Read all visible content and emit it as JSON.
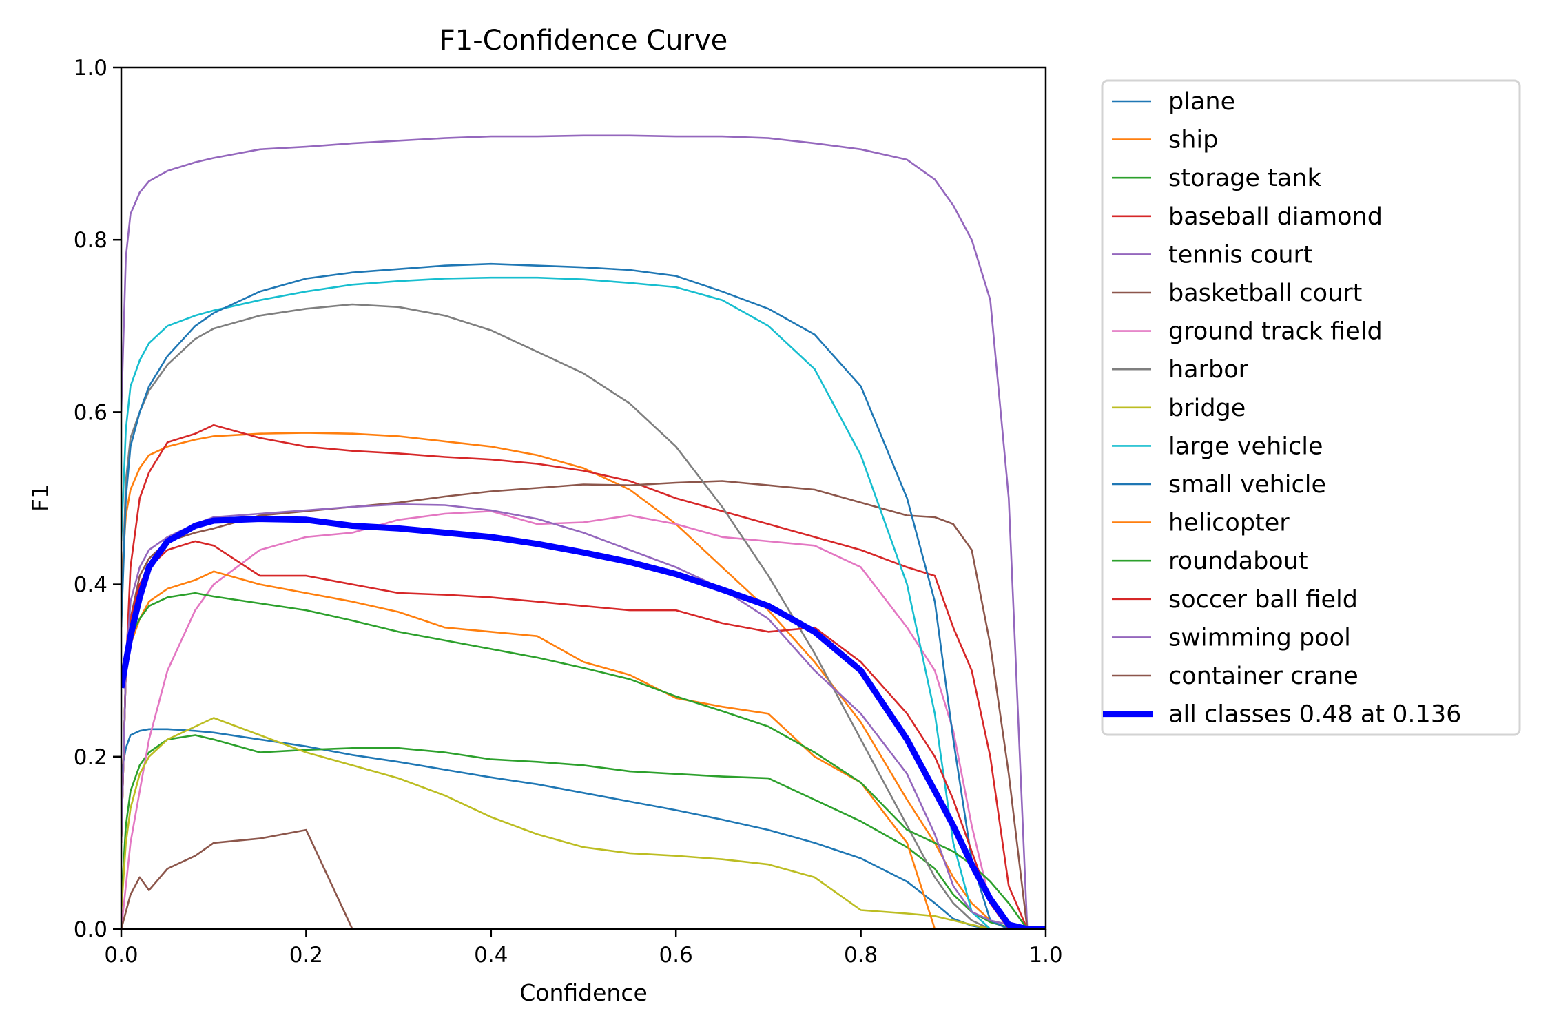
{
  "chart_data": {
    "type": "line",
    "title": "F1-Confidence Curve",
    "xlabel": "Confidence",
    "ylabel": "F1",
    "xlim": [
      0.0,
      1.0
    ],
    "ylim": [
      0.0,
      1.0
    ],
    "xticks": [
      "0.0",
      "0.2",
      "0.4",
      "0.6",
      "0.8",
      "1.0"
    ],
    "yticks": [
      "0.0",
      "0.2",
      "0.4",
      "0.6",
      "0.8",
      "1.0"
    ],
    "grid": false,
    "legend_position": "outside-right-top",
    "x": [
      0.0,
      0.005,
      0.01,
      0.02,
      0.03,
      0.05,
      0.08,
      0.1,
      0.15,
      0.2,
      0.25,
      0.3,
      0.35,
      0.4,
      0.45,
      0.5,
      0.55,
      0.6,
      0.65,
      0.7,
      0.75,
      0.8,
      0.85,
      0.88,
      0.9,
      0.92,
      0.94,
      0.96,
      0.98,
      1.0
    ],
    "series": [
      {
        "name": "plane",
        "color": "#1f77b4",
        "width": "thin",
        "values": [
          0.18,
          0.21,
          0.225,
          0.23,
          0.232,
          0.232,
          0.23,
          0.228,
          0.22,
          0.212,
          0.202,
          0.194,
          0.185,
          0.176,
          0.168,
          0.158,
          0.148,
          0.138,
          0.127,
          0.115,
          0.1,
          0.082,
          0.055,
          0.03,
          0.012,
          0.004,
          0.0,
          0.0,
          0.0,
          0.0
        ]
      },
      {
        "name": "ship",
        "color": "#ff7f0e",
        "width": "thin",
        "values": [
          0.4,
          0.48,
          0.51,
          0.535,
          0.55,
          0.56,
          0.568,
          0.572,
          0.575,
          0.576,
          0.575,
          0.572,
          0.566,
          0.56,
          0.55,
          0.535,
          0.51,
          0.47,
          0.42,
          0.37,
          0.31,
          0.24,
          0.15,
          0.1,
          0.06,
          0.03,
          0.01,
          0.0,
          0.0,
          0.0
        ]
      },
      {
        "name": "storage tank",
        "color": "#2ca02c",
        "width": "thin",
        "values": [
          0.03,
          0.12,
          0.16,
          0.19,
          0.205,
          0.22,
          0.225,
          0.22,
          0.205,
          0.208,
          0.21,
          0.21,
          0.205,
          0.197,
          0.194,
          0.19,
          0.183,
          0.18,
          0.177,
          0.175,
          0.15,
          0.125,
          0.095,
          0.07,
          0.04,
          0.02,
          0.008,
          0.002,
          0.0,
          0.0
        ]
      },
      {
        "name": "baseball diamond",
        "color": "#d62728",
        "width": "thin",
        "values": [
          0.1,
          0.3,
          0.42,
          0.5,
          0.53,
          0.565,
          0.575,
          0.585,
          0.57,
          0.56,
          0.555,
          0.552,
          0.548,
          0.545,
          0.54,
          0.532,
          0.52,
          0.5,
          0.485,
          0.47,
          0.455,
          0.44,
          0.42,
          0.41,
          0.35,
          0.3,
          0.2,
          0.05,
          0.0,
          0.0
        ]
      },
      {
        "name": "tennis court",
        "color": "#9467bd",
        "width": "thin",
        "values": [
          0.6,
          0.78,
          0.83,
          0.855,
          0.868,
          0.88,
          0.89,
          0.895,
          0.905,
          0.908,
          0.912,
          0.915,
          0.918,
          0.92,
          0.92,
          0.921,
          0.921,
          0.92,
          0.92,
          0.918,
          0.912,
          0.905,
          0.893,
          0.87,
          0.84,
          0.8,
          0.73,
          0.5,
          0.0,
          0.0
        ]
      },
      {
        "name": "basketball court",
        "color": "#8c564b",
        "width": "thin",
        "values": [
          0.1,
          0.3,
          0.36,
          0.41,
          0.43,
          0.45,
          0.46,
          0.465,
          0.48,
          0.485,
          0.49,
          0.495,
          0.502,
          0.508,
          0.512,
          0.516,
          0.515,
          0.518,
          0.52,
          0.515,
          0.51,
          0.495,
          0.48,
          0.478,
          0.47,
          0.44,
          0.33,
          0.18,
          0.0,
          0.0
        ]
      },
      {
        "name": "ground track field",
        "color": "#e377c2",
        "width": "thin",
        "values": [
          0.0,
          0.05,
          0.1,
          0.16,
          0.22,
          0.3,
          0.37,
          0.4,
          0.44,
          0.455,
          0.46,
          0.475,
          0.482,
          0.485,
          0.47,
          0.472,
          0.48,
          0.47,
          0.455,
          0.45,
          0.445,
          0.42,
          0.35,
          0.3,
          0.23,
          0.12,
          0.03,
          0.0,
          0.0,
          0.0
        ]
      },
      {
        "name": "harbor",
        "color": "#7f7f7f",
        "width": "thin",
        "values": [
          0.36,
          0.52,
          0.57,
          0.6,
          0.625,
          0.655,
          0.685,
          0.697,
          0.712,
          0.72,
          0.725,
          0.722,
          0.712,
          0.695,
          0.67,
          0.645,
          0.61,
          0.56,
          0.49,
          0.41,
          0.32,
          0.22,
          0.12,
          0.06,
          0.03,
          0.01,
          0.0,
          0.0,
          0.0,
          0.0
        ]
      },
      {
        "name": "bridge",
        "color": "#bcbd22",
        "width": "thin",
        "values": [
          0.02,
          0.1,
          0.14,
          0.18,
          0.2,
          0.22,
          0.235,
          0.245,
          0.225,
          0.205,
          0.19,
          0.175,
          0.155,
          0.13,
          0.11,
          0.095,
          0.088,
          0.085,
          0.081,
          0.075,
          0.06,
          0.022,
          0.018,
          0.015,
          0.01,
          0.005,
          0.0,
          0.0,
          0.0,
          0.0
        ]
      },
      {
        "name": "large vehicle",
        "color": "#17becf",
        "width": "thin",
        "values": [
          0.45,
          0.58,
          0.63,
          0.66,
          0.68,
          0.7,
          0.712,
          0.718,
          0.73,
          0.74,
          0.748,
          0.752,
          0.755,
          0.756,
          0.756,
          0.754,
          0.75,
          0.745,
          0.73,
          0.7,
          0.65,
          0.55,
          0.4,
          0.25,
          0.1,
          0.02,
          0.0,
          0.0,
          0.0,
          0.0
        ]
      },
      {
        "name": "small vehicle",
        "color": "#1f77b4",
        "width": "thin",
        "values": [
          0.35,
          0.5,
          0.56,
          0.6,
          0.63,
          0.665,
          0.7,
          0.715,
          0.74,
          0.755,
          0.762,
          0.766,
          0.77,
          0.772,
          0.77,
          0.768,
          0.765,
          0.758,
          0.74,
          0.72,
          0.69,
          0.63,
          0.5,
          0.38,
          0.22,
          0.08,
          0.01,
          0.0,
          0.0,
          0.0
        ]
      },
      {
        "name": "helicopter",
        "color": "#ff7f0e",
        "width": "thin",
        "values": [
          0.1,
          0.3,
          0.33,
          0.36,
          0.38,
          0.395,
          0.405,
          0.415,
          0.4,
          0.39,
          0.38,
          0.368,
          0.35,
          0.345,
          0.34,
          0.31,
          0.295,
          0.268,
          0.258,
          0.25,
          0.2,
          0.17,
          0.1,
          0.0,
          0.0,
          0.0,
          0.0,
          0.0,
          0.0,
          0.0
        ]
      },
      {
        "name": "roundabout",
        "color": "#2ca02c",
        "width": "thin",
        "values": [
          0.1,
          0.3,
          0.34,
          0.36,
          0.375,
          0.385,
          0.39,
          0.386,
          0.378,
          0.37,
          0.358,
          0.345,
          0.335,
          0.325,
          0.315,
          0.303,
          0.29,
          0.27,
          0.253,
          0.235,
          0.205,
          0.17,
          0.115,
          0.1,
          0.09,
          0.075,
          0.055,
          0.03,
          0.0,
          0.0
        ]
      },
      {
        "name": "soccer ball field",
        "color": "#d62728",
        "width": "thin",
        "values": [
          0.1,
          0.3,
          0.36,
          0.4,
          0.42,
          0.44,
          0.45,
          0.445,
          0.41,
          0.41,
          0.4,
          0.39,
          0.388,
          0.385,
          0.38,
          0.375,
          0.37,
          0.37,
          0.355,
          0.345,
          0.35,
          0.31,
          0.25,
          0.2,
          0.15,
          0.09,
          0.03,
          0.0,
          0.0,
          0.0
        ]
      },
      {
        "name": "swimming pool",
        "color": "#9467bd",
        "width": "thin",
        "values": [
          0.1,
          0.3,
          0.38,
          0.42,
          0.44,
          0.455,
          0.47,
          0.478,
          0.482,
          0.486,
          0.49,
          0.493,
          0.492,
          0.486,
          0.476,
          0.46,
          0.44,
          0.42,
          0.395,
          0.36,
          0.3,
          0.25,
          0.18,
          0.11,
          0.05,
          0.02,
          0.01,
          0.005,
          0.0,
          0.0
        ]
      },
      {
        "name": "container crane",
        "color": "#8c564b",
        "width": "thin",
        "values": [
          0.0,
          0.02,
          0.04,
          0.06,
          0.045,
          0.07,
          0.085,
          0.1,
          0.105,
          0.115,
          0.0,
          0.0,
          0.0,
          0.0,
          0.0,
          0.0,
          0.0,
          0.0,
          0.0,
          0.0,
          0.0,
          0.0,
          0.0,
          0.0,
          0.0,
          0.0,
          0.0,
          0.0,
          0.0,
          0.0
        ]
      },
      {
        "name": "all classes 0.48 at 0.136",
        "color": "#0000ff",
        "width": "thick",
        "values": [
          0.28,
          0.31,
          0.34,
          0.385,
          0.42,
          0.45,
          0.468,
          0.474,
          0.476,
          0.475,
          0.468,
          0.465,
          0.46,
          0.455,
          0.447,
          0.437,
          0.426,
          0.412,
          0.394,
          0.375,
          0.345,
          0.3,
          0.22,
          0.16,
          0.12,
          0.075,
          0.035,
          0.005,
          0.0,
          0.0
        ]
      }
    ],
    "annotation": {
      "best_f1": 0.48,
      "at_confidence": 0.136
    }
  }
}
